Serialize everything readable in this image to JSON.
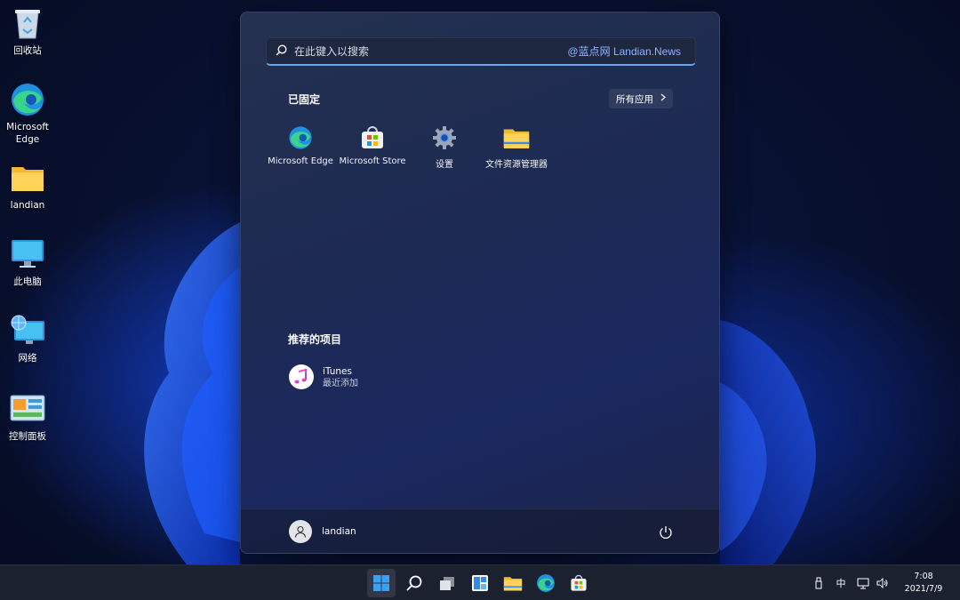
{
  "desktop": {
    "icons": [
      {
        "label": "回收站",
        "icon": "recycle-bin-icon"
      },
      {
        "label": "Microsoft Edge",
        "icon": "edge-icon"
      },
      {
        "label": "landian",
        "icon": "folder-icon"
      },
      {
        "label": "此电脑",
        "icon": "monitor-icon"
      },
      {
        "label": "网络",
        "icon": "network-icon"
      },
      {
        "label": "控制面板",
        "icon": "control-panel-icon"
      }
    ]
  },
  "start_menu": {
    "search": {
      "placeholder": "在此键入以搜索",
      "watermark": "@蓝点网 Landian.News"
    },
    "pinned": {
      "title": "已固定",
      "all_apps_label": "所有应用",
      "apps": [
        {
          "label": "Microsoft Edge",
          "icon": "edge-icon"
        },
        {
          "label": "Microsoft Store",
          "icon": "store-icon"
        },
        {
          "label": "设置",
          "icon": "gear-icon"
        },
        {
          "label": "文件资源管理器",
          "icon": "folder-icon"
        }
      ]
    },
    "recommended": {
      "title": "推荐的项目",
      "items": [
        {
          "name": "iTunes",
          "subtitle": "最近添加",
          "icon": "itunes-icon"
        }
      ]
    },
    "footer": {
      "username": "landian"
    }
  },
  "taskbar": {
    "items": [
      "start-icon",
      "search-icon",
      "task-view-icon",
      "widgets-icon",
      "file-explorer-icon",
      "edge-icon",
      "store-icon"
    ],
    "tray": {
      "ime": "中",
      "time": "7:08",
      "date": "2021/7/9"
    }
  },
  "colors": {
    "accent": "#6aa6e8",
    "start_bg": "#1f2b55",
    "taskbar_bg": "#1c2130"
  }
}
